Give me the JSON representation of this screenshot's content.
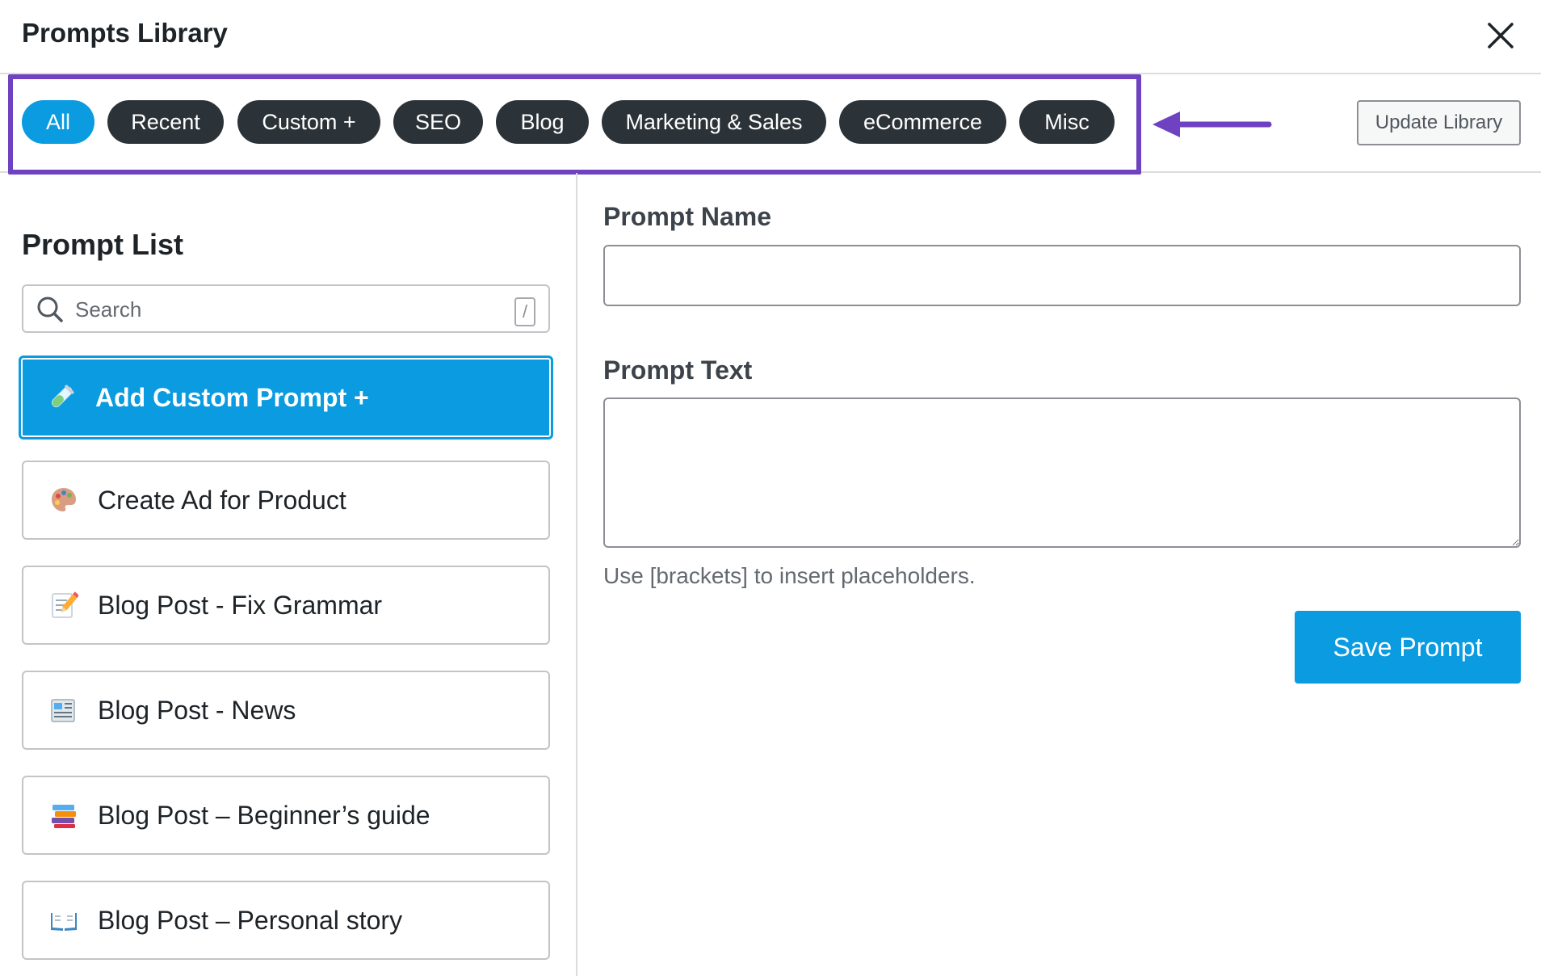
{
  "header": {
    "title": "Prompts Library"
  },
  "filters": {
    "chips": [
      {
        "label": "All",
        "active": true
      },
      {
        "label": "Recent",
        "active": false
      },
      {
        "label": "Custom +",
        "active": false
      },
      {
        "label": "SEO",
        "active": false
      },
      {
        "label": "Blog",
        "active": false
      },
      {
        "label": "Marketing & Sales",
        "active": false
      },
      {
        "label": "eCommerce",
        "active": false
      },
      {
        "label": "Misc",
        "active": false
      }
    ],
    "update_label": "Update Library"
  },
  "prompt_list": {
    "title": "Prompt List",
    "search_placeholder": "Search",
    "search_shortcut": "/",
    "items": [
      {
        "label": "Add Custom Prompt +",
        "icon": "test-tube-icon",
        "selected": true
      },
      {
        "label": "Create Ad for Product",
        "icon": "palette-icon"
      },
      {
        "label": "Blog Post - Fix Grammar",
        "icon": "memo-pencil-icon"
      },
      {
        "label": "Blog Post - News",
        "icon": "newspaper-icon"
      },
      {
        "label": "Blog Post – Beginner’s guide",
        "icon": "books-icon"
      },
      {
        "label": "Blog Post – Personal story",
        "icon": "open-book-icon"
      }
    ]
  },
  "form": {
    "name_label": "Prompt Name",
    "name_value": "",
    "text_label": "Prompt Text",
    "text_value": "",
    "hint": "Use [brackets] to insert placeholders.",
    "save_label": "Save Prompt"
  },
  "colors": {
    "accent": "#0a9be0",
    "chip_dark": "#2c3338",
    "highlight": "#6f42c1"
  }
}
